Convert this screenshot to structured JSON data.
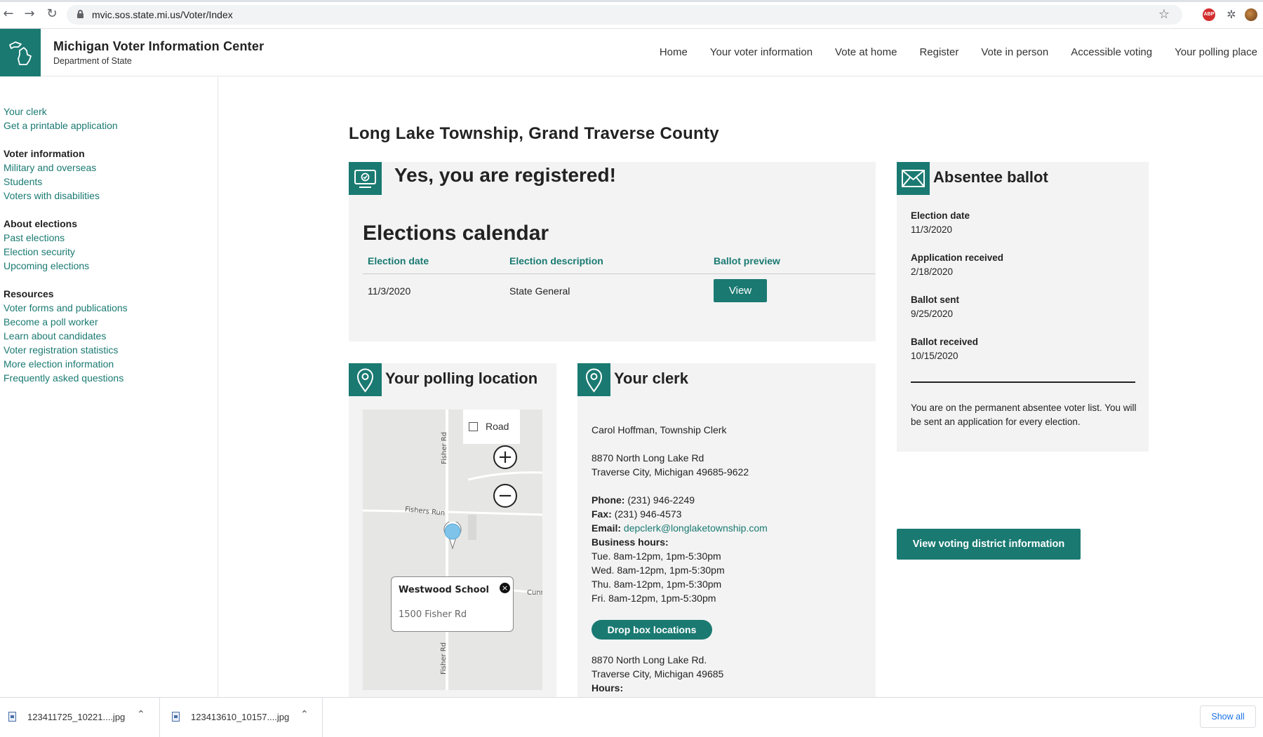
{
  "browser": {
    "url": "mvic.sos.state.mi.us/Voter/Index",
    "back_icon": "←",
    "forward_icon": "→",
    "reload_icon": "↻",
    "star_icon": "☆",
    "abp_label": "ABP",
    "puzzle_icon": "✲"
  },
  "site": {
    "title": "Michigan Voter Information Center",
    "subtitle": "Department of State",
    "nav": [
      "Home",
      "Your voter information",
      "Vote at home",
      "Register",
      "Vote in person",
      "Accessible voting",
      "Your polling place"
    ]
  },
  "sidebar": {
    "top_links": [
      "Your clerk",
      "Get a printable application"
    ],
    "groups": [
      {
        "heading": "Voter information",
        "links": [
          "Military and overseas",
          "Students",
          "Voters with disabilities"
        ]
      },
      {
        "heading": "About elections",
        "links": [
          "Past elections",
          "Election security",
          "Upcoming elections"
        ]
      },
      {
        "heading": "Resources",
        "links": [
          "Voter forms and publications",
          "Become a poll worker",
          "Learn about candidates",
          "Voter registration statistics",
          "More election information",
          "Frequently asked questions"
        ]
      }
    ]
  },
  "main": {
    "title": "Long Lake Township, Grand Traverse County",
    "registration": {
      "heading": "Yes, you are registered!",
      "calendar_title": "Elections calendar",
      "columns": [
        "Election date",
        "Election description",
        "Ballot preview"
      ],
      "rows": [
        {
          "date": "11/3/2020",
          "description": "State General",
          "action": "View"
        }
      ]
    },
    "polling": {
      "heading": "Your polling location",
      "map_type": "Road",
      "zoom_in": "+",
      "zoom_out": "−",
      "location_name": "Westwood School",
      "location_address": "1500 Fisher Rd",
      "close_icon": "×",
      "map_labels": {
        "fisher_rd_top": "Fisher Rd",
        "fishers_run": "Fishers Run",
        "cunn": "Cunn",
        "fisher_rd_bottom": "Fisher Rd"
      }
    },
    "clerk": {
      "heading": "Your clerk",
      "name": "Carol Hoffman, Township Clerk",
      "address1": "8870 North Long Lake Rd",
      "address2": "Traverse City, Michigan 49685-9622",
      "phone_label": "Phone:",
      "phone": "(231) 946-2249",
      "fax_label": "Fax:",
      "fax": "(231) 946-4573",
      "email_label": "Email:",
      "email": "depclerk@longlaketownship.com",
      "hours_label": "Business hours:",
      "hours": [
        "Tue. 8am-12pm, 1pm-5:30pm",
        "Wed. 8am-12pm, 1pm-5:30pm",
        "Thu. 8am-12pm, 1pm-5:30pm",
        "Fri. 8am-12pm, 1pm-5:30pm"
      ],
      "dropbox_button": "Drop box locations",
      "dropbox_address1": "8870 North Long Lake Rd.",
      "dropbox_address2": "Traverse City, Michigan 49685",
      "dropbox_hours_label": "Hours:"
    },
    "absentee": {
      "heading": "Absentee ballot",
      "items": [
        {
          "label": "Election date",
          "value": "11/3/2020"
        },
        {
          "label": "Application received",
          "value": "2/18/2020"
        },
        {
          "label": "Ballot sent",
          "value": "9/25/2020"
        },
        {
          "label": "Ballot received",
          "value": "10/15/2020"
        }
      ],
      "note": "You are on the permanent absentee voter list. You will be sent an application for every election."
    },
    "district_button": "View voting district information"
  },
  "downloads": {
    "items": [
      "123411725_10221....jpg",
      "123413610_10157....jpg"
    ],
    "chevron": "⌃",
    "show_all": "Show all"
  },
  "colors": {
    "accent": "#1a7a72",
    "card_bg": "#f3f3f3"
  }
}
